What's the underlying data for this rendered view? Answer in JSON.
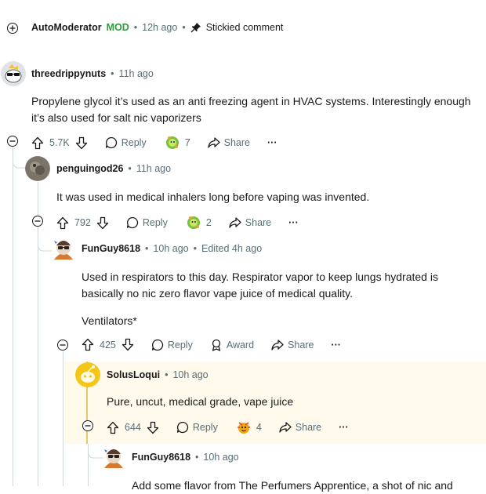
{
  "automod": {
    "username": "AutoModerator",
    "badge": "MOD",
    "time": "12h ago",
    "stickied": "Stickied comment"
  },
  "c1": {
    "username": "threedrippynuts",
    "time": "11h ago",
    "body": "Propylene glycol it’s used as an anti freezing agent in HVAC systems. Interestingly enough it’s also used for salt nic vaporizers",
    "votes": "5.7K",
    "reply": "Reply",
    "award_count": "7",
    "share": "Share"
  },
  "c2": {
    "username": "penguingod26",
    "time": "11h ago",
    "body": "It was used in medical inhalers long before vaping was invented.",
    "votes": "792",
    "reply": "Reply",
    "award_count": "2",
    "share": "Share"
  },
  "c3": {
    "username": "FunGuy8618",
    "time": "10h ago",
    "edited": "Edited 4h ago",
    "body1": "Used in respirators to this day. Respirator vapor to keep lungs hydrated is basically no nic zero flavor vape juice of medical quality.",
    "body2": "Ventilators*",
    "votes": "425",
    "reply": "Reply",
    "award": "Award",
    "share": "Share"
  },
  "c4": {
    "username": "SolusLoqui",
    "time": "10h ago",
    "body": "Pure, uncut, medical grade, vape juice",
    "votes": "644",
    "reply": "Reply",
    "award_count": "4",
    "share": "Share"
  },
  "c5": {
    "username": "FunGuy8618",
    "time": "10h ago",
    "body_partial": "Add some flavor from The Perfumers Apprentice, a shot of nic and"
  },
  "colors": {
    "mod_green": "#2a9d3a",
    "meta": "#576f76",
    "highlight": "#fffaeb",
    "highlight_bar": "#e6c76a"
  }
}
